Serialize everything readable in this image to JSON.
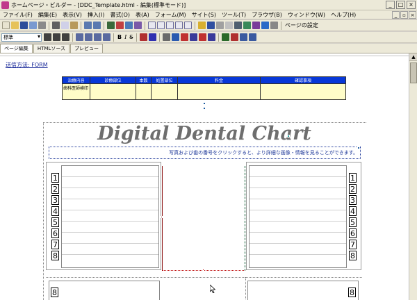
{
  "window": {
    "title": "ホームページ・ビルダー - [DDC_Template.html  - 編集(標準モード)]",
    "min": "_",
    "max": "□",
    "close": "×"
  },
  "menubar": [
    "ファイル(F)",
    "編集(E)",
    "表示(V)",
    "挿入(I)",
    "書式(O)",
    "表(A)",
    "フォーム(M)",
    "サイト(S)",
    "ツール(T)",
    "ブラウザ(B)",
    "ウィンドウ(W)",
    "ヘルプ(H)"
  ],
  "toolbar1": {
    "page_setup": "ページの設定"
  },
  "toolbar2": {
    "style_value": "標準",
    "bold": "B",
    "italic": "I",
    "strike": "S"
  },
  "tabs": [
    "ページ編集",
    "HTMLソース",
    "プレビュー"
  ],
  "form": {
    "label": "送信方法: FORM",
    "table_headers": [
      "治療内容",
      "診療部位",
      "本数",
      "処置部位",
      "料金",
      "確認事項"
    ],
    "table_cells": [
      "歯科医師検印",
      "",
      "",
      "",
      "",
      ""
    ]
  },
  "chart": {
    "title": "Digital Dental Chart",
    "instruction": "写真および歯の番号をクリックすると、より詳細な画像・情報を見ることができます。"
  },
  "teeth_left": [
    "1",
    "2",
    "3",
    "4",
    "5",
    "6",
    "7",
    "8"
  ],
  "teeth_right": [
    "1",
    "2",
    "3",
    "4",
    "5",
    "6",
    "7",
    "8"
  ],
  "lower_left_first": "8",
  "lower_right_first": "8",
  "colors": {
    "header_blue": "#0838d8",
    "cell_yellow": "#fffdc8",
    "title_gray": "#6e6e6e",
    "link_blue": "#203a9a"
  }
}
